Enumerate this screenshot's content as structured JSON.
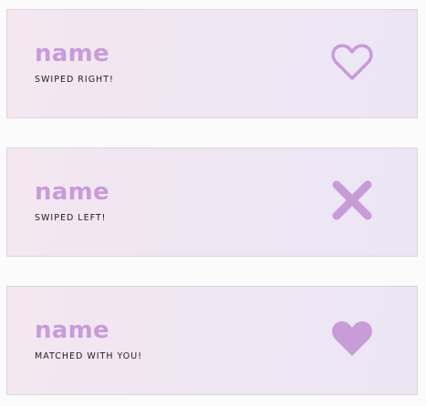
{
  "colors": {
    "accent": "#c89bd9",
    "card_border": "#ddd4e0",
    "text_dark": "#222222",
    "page_background": "#fbfbfb"
  },
  "cards": [
    {
      "name": "name",
      "status": "SWIPED RIGHT!",
      "icon": "heart-outline-icon"
    },
    {
      "name": "name",
      "status": "SWIPED LEFT!",
      "icon": "cross-icon"
    },
    {
      "name": "name",
      "status": "MATCHED WITH YOU!",
      "icon": "heart-filled-icon"
    }
  ]
}
